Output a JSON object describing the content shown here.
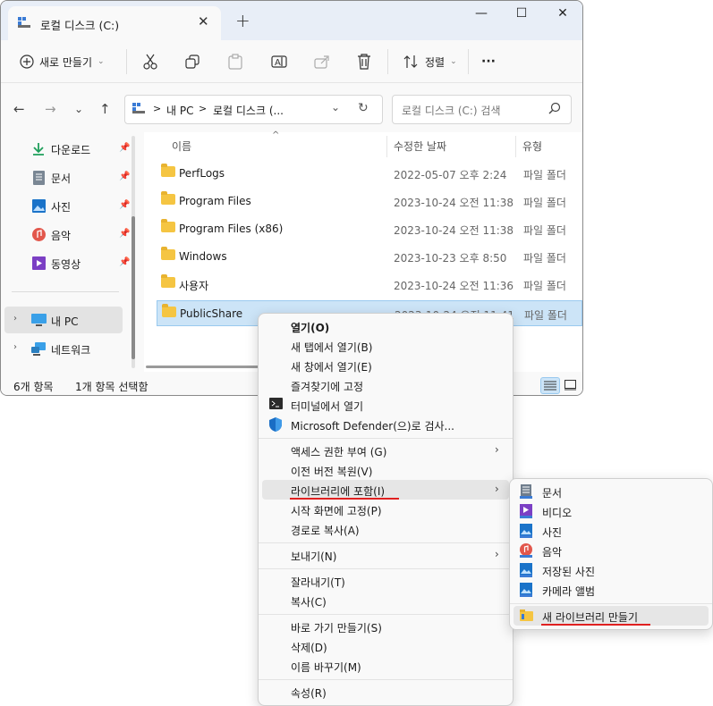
{
  "tab": {
    "title": "로컬 디스크 (C:)",
    "close": "✕",
    "new": "+"
  },
  "window_controls": {
    "minimize": "—",
    "maximize": "☐",
    "close": "✕"
  },
  "toolbar": {
    "new_label": "새로 만들기",
    "sort_label": "정렬",
    "more": "···"
  },
  "address": {
    "pc": "내 PC",
    "sep": ">",
    "drive": "로컬 디스크 (..."
  },
  "search": {
    "placeholder": "로컬 디스크 (C:) 검색"
  },
  "nav": {
    "items": [
      {
        "label": "다운로드",
        "icon": "download-icon",
        "color": "#1e9e5a"
      },
      {
        "label": "문서",
        "icon": "document-icon",
        "color": "#7a8794"
      },
      {
        "label": "사진",
        "icon": "picture-icon",
        "color": "#1a73c9"
      },
      {
        "label": "음악",
        "icon": "music-icon",
        "color": "#e2574c"
      },
      {
        "label": "동영상",
        "icon": "video-icon",
        "color": "#7b3fc4"
      }
    ],
    "thispc": "내 PC",
    "network": "네트워크"
  },
  "columns": {
    "name": "이름",
    "date": "수정한 날짜",
    "type": "유형"
  },
  "files": [
    {
      "name": "PerfLogs",
      "date": "2022-05-07 오후 2:24",
      "type": "파일 폴더"
    },
    {
      "name": "Program Files",
      "date": "2023-10-24 오전 11:38",
      "type": "파일 폴더"
    },
    {
      "name": "Program Files (x86)",
      "date": "2023-10-24 오전 11:38",
      "type": "파일 폴더"
    },
    {
      "name": "Windows",
      "date": "2023-10-23 오후 8:50",
      "type": "파일 폴더"
    },
    {
      "name": "사용자",
      "date": "2023-10-24 오전 11:36",
      "type": "파일 폴더"
    },
    {
      "name": "PublicShare",
      "date": "2023-10-24 오전 11:41",
      "type": "파일 폴더"
    }
  ],
  "status": {
    "count": "6개 항목",
    "selected": "1개 항목 선택함"
  },
  "context_menu": {
    "open": "열기(O)",
    "new_tab": "새 탭에서 열기(B)",
    "new_window": "새 창에서 열기(E)",
    "pin_fav": "즐겨찾기에 고정",
    "terminal": "터미널에서 열기",
    "defender": "Microsoft Defender(으)로 검사...",
    "access": "액세스 권한 부여 (G)",
    "restore": "이전 버전 복원(V)",
    "library": "라이브러리에 포함(I)",
    "pin_start": "시작 화면에 고정(P)",
    "copy_path": "경로로 복사(A)",
    "send_to": "보내기(N)",
    "cut": "잘라내기(T)",
    "copy": "복사(C)",
    "shortcut": "바로 가기 만들기(S)",
    "delete": "삭제(D)",
    "rename": "이름 바꾸기(M)",
    "properties": "속성(R)"
  },
  "submenu": {
    "items": [
      {
        "label": "문서",
        "icon": "document-library-icon",
        "color": "#6f7d8c"
      },
      {
        "label": "비디오",
        "icon": "video-library-icon",
        "color": "#7b3fc4"
      },
      {
        "label": "사진",
        "icon": "picture-library-icon",
        "color": "#1a73c9"
      },
      {
        "label": "음악",
        "icon": "music-library-icon",
        "color": "#e2574c"
      },
      {
        "label": "저장된 사진",
        "icon": "saved-pictures-icon",
        "color": "#1a73c9"
      },
      {
        "label": "카메라 앨범",
        "icon": "camera-roll-icon",
        "color": "#1a73c9"
      }
    ],
    "new_library": "새 라이브러리 만들기"
  }
}
